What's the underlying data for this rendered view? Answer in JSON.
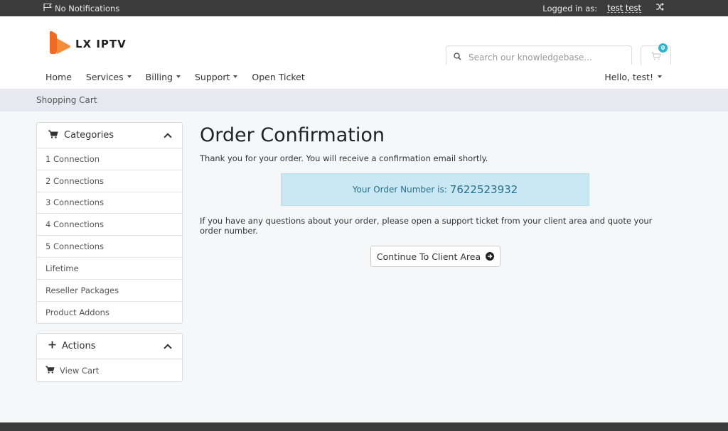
{
  "topbar": {
    "notifications": "No Notifications",
    "logged_in_label": "Logged in as:",
    "username": "test test"
  },
  "header": {
    "logo_text": "LX IPTV",
    "search_placeholder": "Search our knowledgebase...",
    "cart_count": "0"
  },
  "nav": {
    "items": [
      {
        "label": "Home",
        "dropdown": false
      },
      {
        "label": "Services",
        "dropdown": true
      },
      {
        "label": "Billing",
        "dropdown": true
      },
      {
        "label": "Support",
        "dropdown": true
      },
      {
        "label": "Open Ticket",
        "dropdown": false
      }
    ],
    "greeting": "Hello, test!"
  },
  "breadcrumb": "Shopping Cart",
  "sidebar": {
    "categories_title": "Categories",
    "categories": [
      "1 Connection",
      "2 Connections",
      "3 Connections",
      "4 Connections",
      "5 Connections",
      "Lifetime",
      "Reseller Packages",
      "Product Addons"
    ],
    "actions_title": "Actions",
    "actions": [
      "View Cart"
    ]
  },
  "main": {
    "title": "Order Confirmation",
    "thanks": "Thank you for your order. You will receive a confirmation email shortly.",
    "order_label": "Your Order Number is:",
    "order_number": "7622523932",
    "question": "If you have any questions about your order, please open a support ticket from your client area and quote your order number.",
    "continue_label": "Continue To Client Area"
  },
  "colors": {
    "topbar": "#3c3c3c",
    "accent": "#30b3c8",
    "order_box": "#c9e8f3",
    "logo_orange": "#f26a21"
  }
}
